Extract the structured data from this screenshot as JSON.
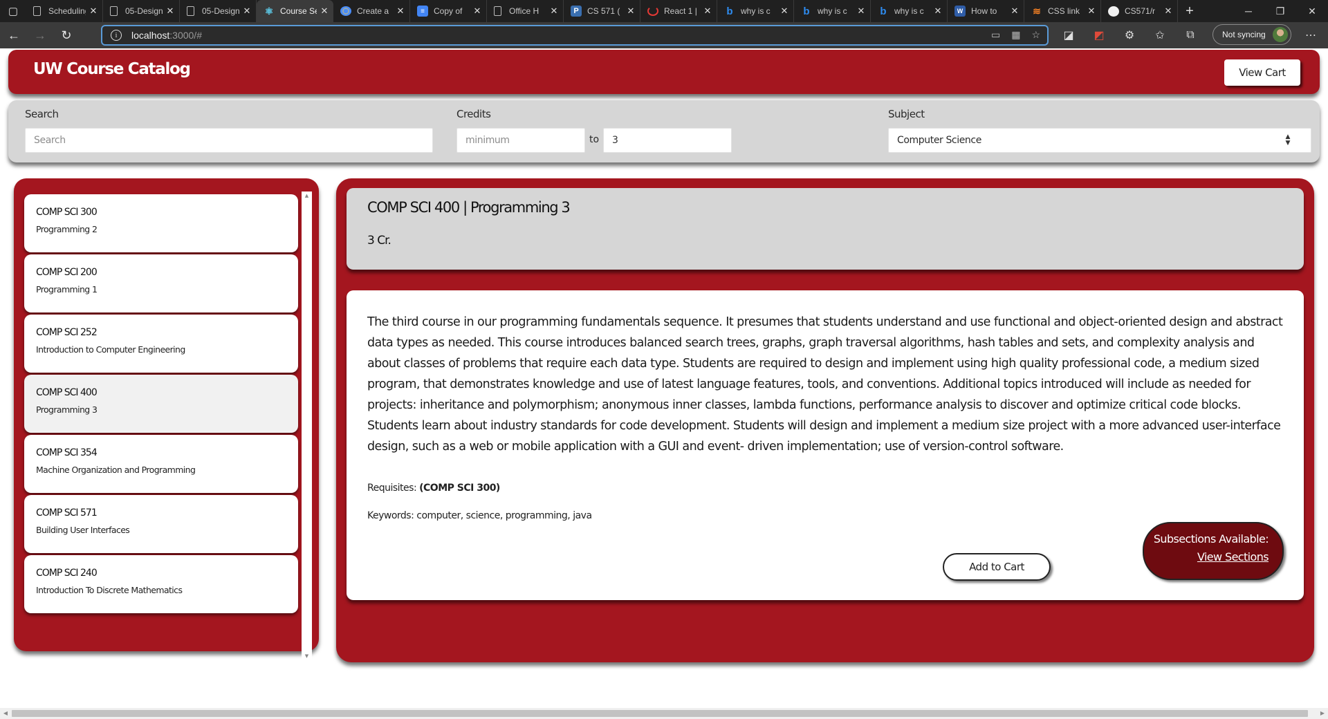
{
  "browser": {
    "tabs": [
      {
        "title": "Scheduling",
        "icon": "doc-icon"
      },
      {
        "title": "05-Design",
        "icon": "doc-icon"
      },
      {
        "title": "05-Design",
        "icon": "doc-icon"
      },
      {
        "title": "Course Search",
        "icon": "react-icon",
        "active": true
      },
      {
        "title": "Create a",
        "icon": "chrome-icon"
      },
      {
        "title": "Copy of",
        "icon": "google-doc-icon"
      },
      {
        "title": "Office H",
        "icon": "doc-icon"
      },
      {
        "title": "CS 571 (",
        "icon": "piazza-icon"
      },
      {
        "title": "React 1 |",
        "icon": "loading-icon"
      },
      {
        "title": "why is c",
        "icon": "bing-icon"
      },
      {
        "title": "why is c",
        "icon": "bing-icon"
      },
      {
        "title": "why is c",
        "icon": "bing-icon"
      },
      {
        "title": "How to",
        "icon": "uw-icon"
      },
      {
        "title": "CSS link",
        "icon": "stackoverflow-icon"
      },
      {
        "title": "CS571/r",
        "icon": "github-icon"
      }
    ],
    "url_host": "localhost",
    "url_rest": ":3000/#",
    "sync_label": "Not syncing"
  },
  "header": {
    "title": "UW Course Catalog",
    "view_cart": "View Cart"
  },
  "filters": {
    "search_label": "Search",
    "search_placeholder": "Search",
    "search_value": "",
    "credits_label": "Credits",
    "min_placeholder": "minimum",
    "min_value": "",
    "to_label": "to",
    "max_value": "3",
    "subject_label": "Subject",
    "subject_value": "Computer Science"
  },
  "courses": [
    {
      "code": "COMP SCI 300",
      "name": "Programming 2"
    },
    {
      "code": "COMP SCI 200",
      "name": "Programming 1"
    },
    {
      "code": "COMP SCI 252",
      "name": "Introduction to Computer Engineering"
    },
    {
      "code": "COMP SCI 400",
      "name": "Programming 3",
      "selected": true
    },
    {
      "code": "COMP SCI 354",
      "name": "Machine Organization and Programming"
    },
    {
      "code": "COMP SCI 571",
      "name": "Building User Interfaces"
    },
    {
      "code": "COMP SCI 240",
      "name": "Introduction To Discrete Mathematics"
    }
  ],
  "detail": {
    "title": "COMP SCI 400 | Programming 3",
    "credits": "3 Cr.",
    "description": "The third course in our programming fundamentals sequence. It presumes that students understand and use functional and object-oriented design and abstract data types as needed. This course introduces balanced search trees, graphs, graph traversal algorithms, hash tables and sets, and complexity analysis and about classes of problems that require each data type. Students are required to design and implement using high quality professional code, a medium sized program, that demonstrates knowledge and use of latest language features, tools, and conventions. Additional topics introduced will include as needed for projects: inheritance and polymorphism; anonymous inner classes, lambda functions, performance analysis to discover and optimize critical code blocks. Students learn about industry standards for code development. Students will design and implement a medium size project with a more advanced user-interface design, such as a web or mobile application with a GUI and event- driven implementation; use of version-control software.",
    "requisites_label": "Requisites:",
    "requisites_value": "(COMP SCI 300)",
    "keywords": "Keywords: computer, science, programming, java",
    "add_cart": "Add to Cart",
    "subsections_label": "Subsections Available:",
    "view_sections": "View Sections"
  },
  "colors": {
    "uw_red": "#a4161f",
    "dark_red": "#6e0b10",
    "panel_gray": "#d6d6d6"
  }
}
